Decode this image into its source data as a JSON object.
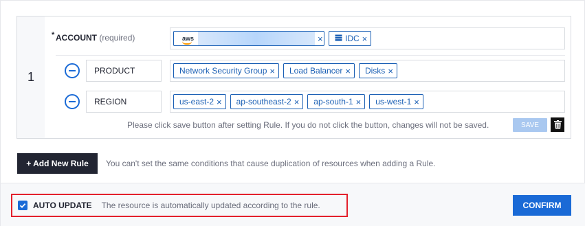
{
  "rule": {
    "index": "1",
    "account": {
      "label": "ACCOUNT",
      "required_text": "(required)",
      "required_marker": "*",
      "tags": [
        {
          "type": "aws",
          "logo_text": "aws",
          "label": ""
        },
        {
          "type": "idc",
          "label": "IDC",
          "icon": "server-icon"
        }
      ]
    },
    "conditions": [
      {
        "key": "PRODUCT",
        "tags": [
          "Network Security Group",
          "Load Balancer",
          "Disks"
        ]
      },
      {
        "key": "REGION",
        "tags": [
          "us-east-2",
          "ap-southeast-2",
          "ap-south-1",
          "us-west-1"
        ]
      }
    ],
    "hint": "Please click save button after setting Rule. If you do not click the button, changes will not be saved.",
    "save_label": "SAVE",
    "delete_icon": "trash-icon"
  },
  "add_rule": {
    "label": "+ Add New Rule",
    "note": "You can't set the same conditions that cause duplication of resources when adding a Rule."
  },
  "footer": {
    "auto_update_label": "AUTO UPDATE",
    "auto_update_checked": true,
    "auto_update_desc": "The resource is automatically updated according to the rule.",
    "confirm_label": "CONFIRM"
  },
  "colors": {
    "accent": "#1a6ad6",
    "tag_border": "#1a5fb4",
    "highlight": "#e3202c",
    "dark_button": "#222532"
  },
  "tag_remove_glyph": "×"
}
